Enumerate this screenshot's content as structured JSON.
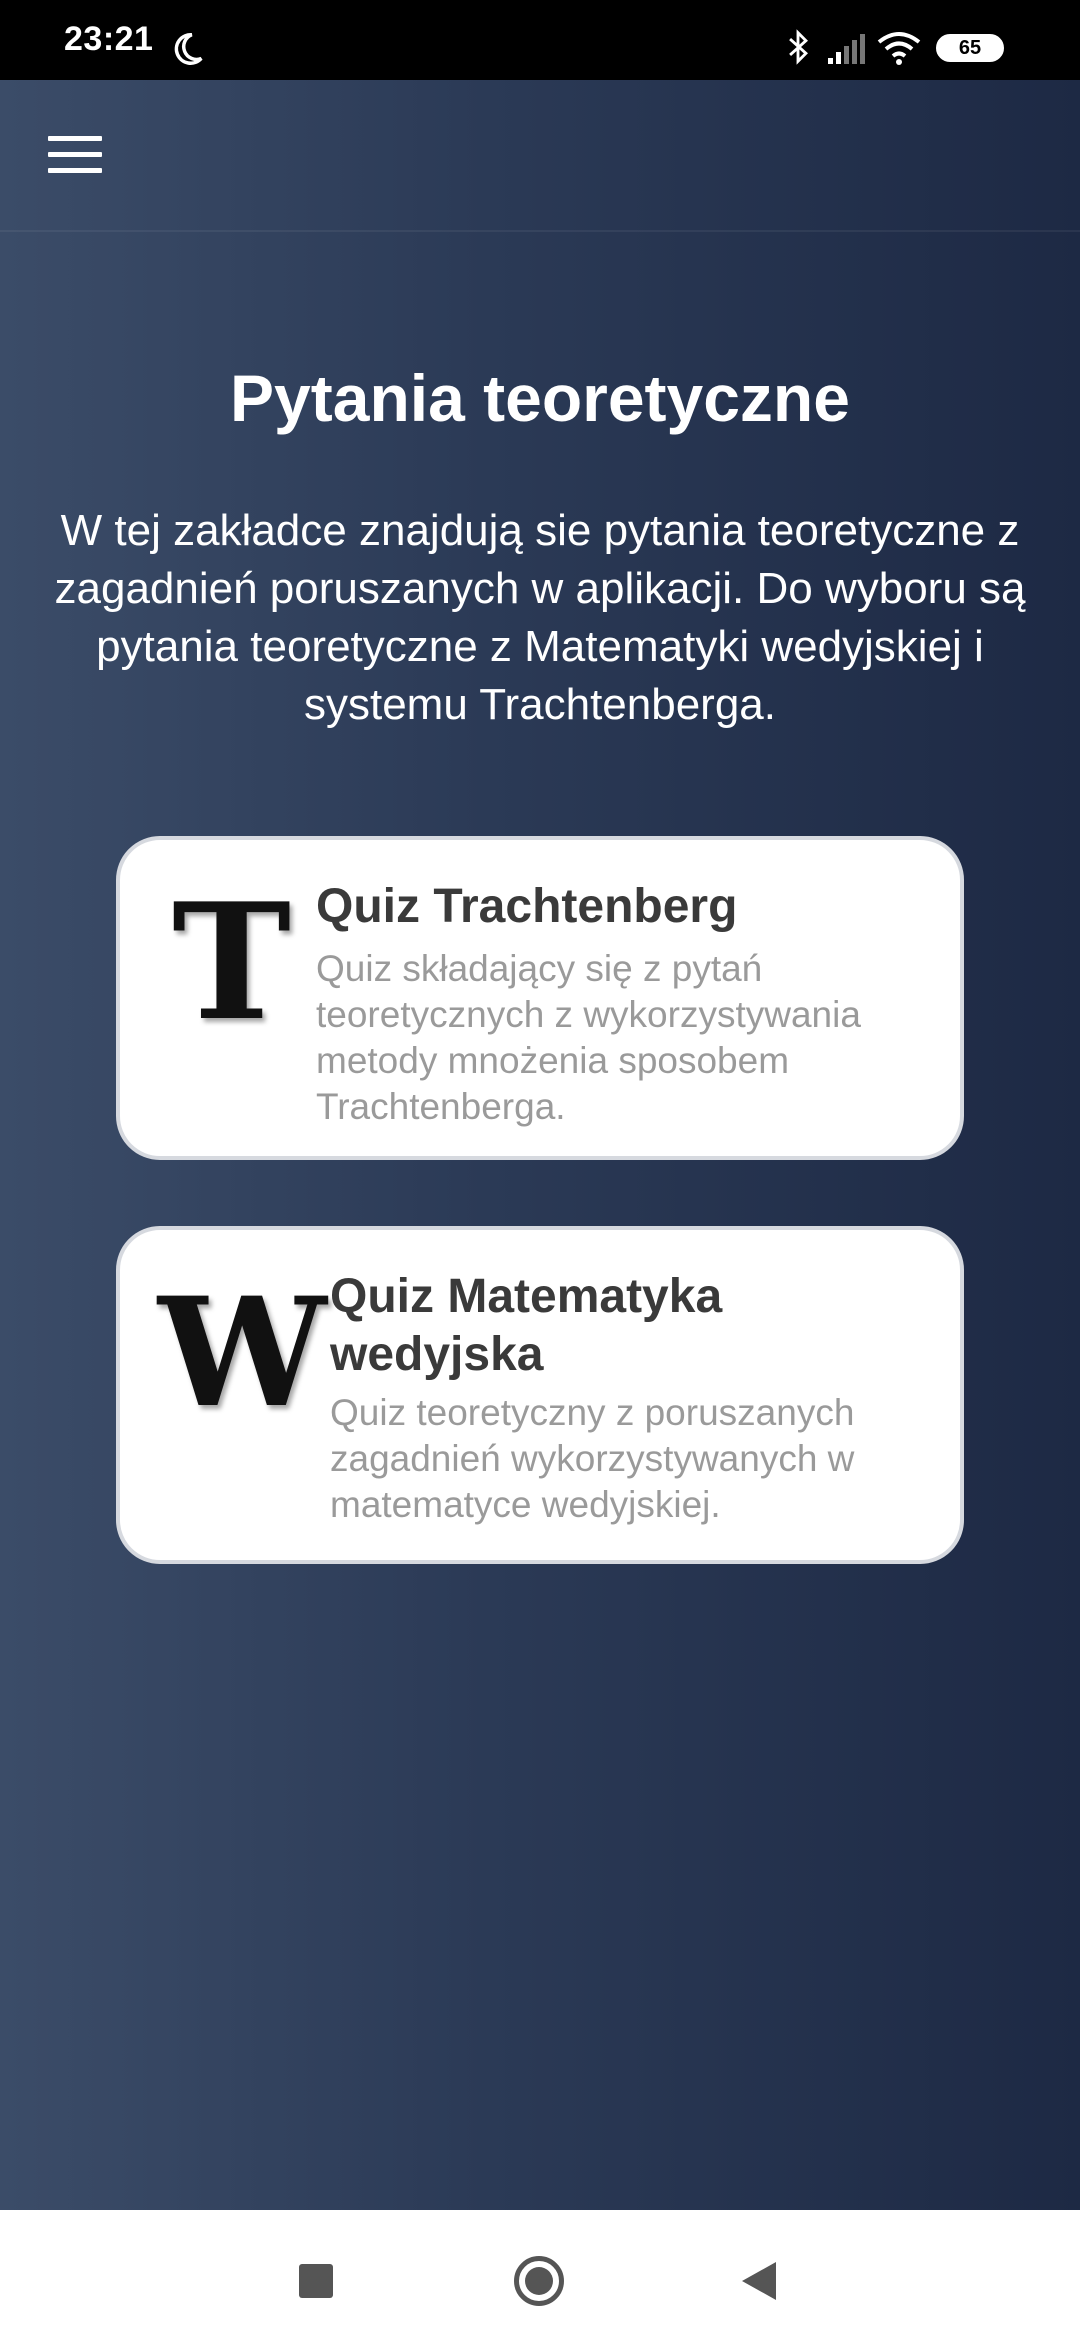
{
  "status_bar": {
    "time": "23:21",
    "battery": "65",
    "icons": [
      "moon-icon",
      "bluetooth-icon",
      "signal-icon",
      "wifi-icon",
      "battery-icon"
    ]
  },
  "toolbar": {
    "menu_icon": "hamburger-menu-icon"
  },
  "page": {
    "title": "Pytania teoretyczne",
    "description": "W tej zakładce znajdują sie pytania teoretyczne z zagadnień poruszanych w aplikacji. Do wyboru są pytania teoretyczne z Matematyki wedyjskiej i systemu Trachtenberga."
  },
  "cards": [
    {
      "letter": "T",
      "title": "Quiz Trachtenberg",
      "description": "Quiz składający się z pytań teoretycznych z wykorzystywania metody mnożenia sposobem Trachtenberga."
    },
    {
      "letter": "W",
      "title": "Quiz Matematyka wedyjska",
      "description": "Quiz teoretyczny z poruszanych zagadnień wykorzystywanych w matematyce wedyjskiej."
    }
  ],
  "nav_bar": {
    "icons": [
      "recent-apps-icon",
      "home-icon",
      "back-icon"
    ]
  },
  "colors": {
    "background_start": "#3b4c68",
    "background_end": "#1d2944",
    "card_background": "#ffffff",
    "card_title": "#3a3a3a",
    "card_description": "#9a9a9a"
  }
}
